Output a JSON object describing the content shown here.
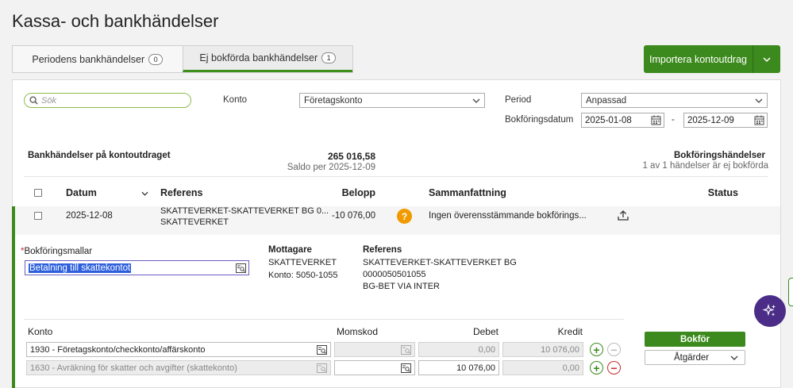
{
  "page": {
    "title": "Kassa- och bankhändelser"
  },
  "tabs": [
    {
      "label": "Periodens bankhändelser",
      "count": "0"
    },
    {
      "label": "Ej bokförda bankhändelser",
      "count": "1"
    }
  ],
  "import_button": {
    "label": "Importera kontoutdrag"
  },
  "filters": {
    "search_placeholder": "Sök",
    "konto_label": "Konto",
    "konto_value": "Företagskonto",
    "period_label": "Period",
    "period_value": "Anpassad",
    "date_label": "Bokföringsdatum",
    "date_from": "2025-01-08",
    "date_separator": "-",
    "date_to": "2025-12-09"
  },
  "summary": {
    "left_label": "Bankhändelser på kontoutdraget",
    "amount": "265 016,58",
    "balance_label": "Saldo per 2025-12-09",
    "right_label": "Bokföringshändelser",
    "right_sub": "1 av 1 händelser är ej bokförda"
  },
  "table": {
    "headers": {
      "date": "Datum",
      "reference": "Referens",
      "amount": "Belopp",
      "summary": "Sammanfattning",
      "status": "Status"
    },
    "row": {
      "date": "2025-12-08",
      "reference_line1": "SKATTEVERKET-SKATTEVERKET BG 0...",
      "reference_line2": "SKATTEVERKET",
      "amount": "-10 076,00",
      "summary": "Ingen överensstämmande bokförings..."
    }
  },
  "detail": {
    "template_required_mark": "*",
    "template_label": "Bokföringsmallar",
    "template_value": "Betalning till skattekontot",
    "recipient_label": "Mottagare",
    "recipient_name": "SKATTEVERKET",
    "recipient_account": "Konto: 5050-1055",
    "reference_label": "Referens",
    "reference_lines": [
      "SKATTEVERKET-SKATTEVERKET BG",
      "0000050501055",
      "BG-BET VIA INTER"
    ]
  },
  "entries": {
    "headers": {
      "konto": "Konto",
      "momskod": "Momskod",
      "debet": "Debet",
      "kredit": "Kredit"
    },
    "rows": [
      {
        "konto": "1930 - Företagskonto/checkkonto/affärskonto",
        "momskod": "",
        "debet": "0,00",
        "kredit": "10 076,00"
      },
      {
        "konto": "1630 - Avräkning för skatter och avgifter (skattekonto)",
        "momskod": "",
        "debet": "10 076,00",
        "kredit": "0,00"
      }
    ]
  },
  "actions": {
    "bokfor": "Bokför",
    "atgarder": "Åtgärder"
  },
  "colors": {
    "brand_green": "#3c8a1d",
    "warning_orange": "#f09a00",
    "ai_purple": "#4b2d87",
    "minus_red": "#cc2b2b"
  }
}
